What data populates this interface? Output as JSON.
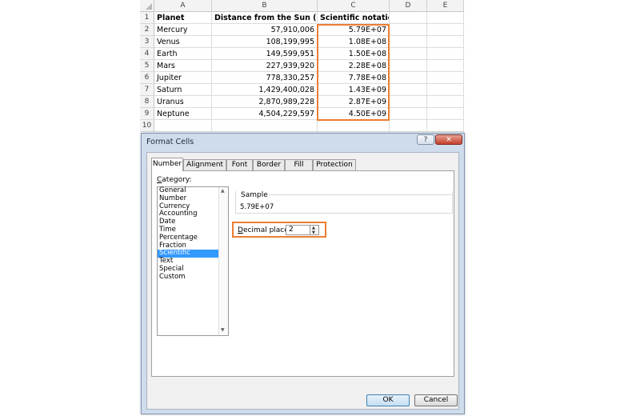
{
  "spreadsheet": {
    "columns": [
      "A",
      "B",
      "C",
      "D",
      "E"
    ],
    "rows": [
      {
        "num": "1",
        "a": "Planet",
        "b": "Distance from the Sun (km)",
        "c": "Scientific notation",
        "header": true
      },
      {
        "num": "2",
        "a": "Mercury",
        "b": "57,910,006",
        "c": "5.79E+07"
      },
      {
        "num": "3",
        "a": "Venus",
        "b": "108,199,995",
        "c": "1.08E+08"
      },
      {
        "num": "4",
        "a": "Earth",
        "b": "149,599,951",
        "c": "1.50E+08"
      },
      {
        "num": "5",
        "a": "Mars",
        "b": "227,939,920",
        "c": "2.28E+08"
      },
      {
        "num": "6",
        "a": "Jupiter",
        "b": "778,330,257",
        "c": "7.78E+08"
      },
      {
        "num": "7",
        "a": "Saturn",
        "b": "1,429,400,028",
        "c": "1.43E+09"
      },
      {
        "num": "8",
        "a": "Uranus",
        "b": "2,870,989,228",
        "c": "2.87E+09"
      },
      {
        "num": "9",
        "a": "Neptune",
        "b": "4,504,229,597",
        "c": "4.50E+09"
      },
      {
        "num": "10",
        "a": "",
        "b": "",
        "c": ""
      }
    ],
    "highlight_color": "#ed7d31"
  },
  "dialog": {
    "title": "Format Cells",
    "help_label": "?",
    "close_label": "✕",
    "tabs": [
      "Number",
      "Alignment",
      "Font",
      "Border",
      "Fill",
      "Protection"
    ],
    "active_tab": "Number",
    "category_label_accel": "C",
    "category_label_rest": "ategory:",
    "categories": [
      "General",
      "Number",
      "Currency",
      "Accounting",
      "Date",
      "Time",
      "Percentage",
      "Fraction",
      "Scientific",
      "Text",
      "Special",
      "Custom"
    ],
    "selected_category": "Scientific",
    "sample_label": "Sample",
    "sample_value": "5.79E+07",
    "decimal_label_accel": "D",
    "decimal_label_rest": "ecimal places:",
    "decimal_value": "2",
    "ok_label": "OK",
    "cancel_label": "Cancel",
    "selection_color": "#3399ff"
  }
}
